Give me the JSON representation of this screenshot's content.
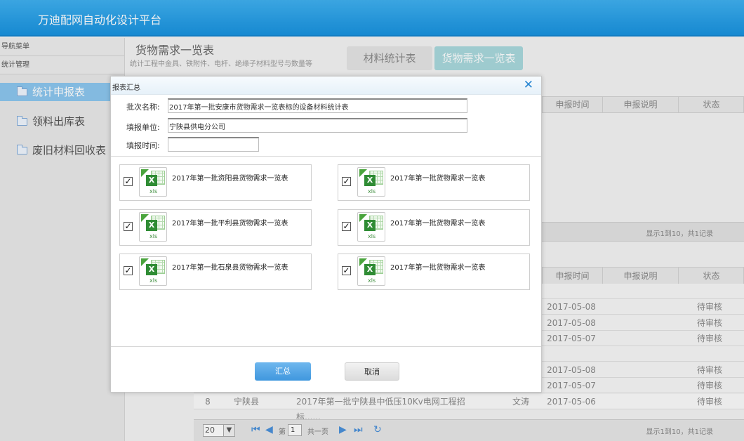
{
  "app": {
    "title": "万迪配网自动化设计平台"
  },
  "sidebar": {
    "nav_header": "导航菜单",
    "section_header": "统计管理",
    "items": [
      {
        "label": "统计申报表",
        "active": true
      },
      {
        "label": "领料出库表",
        "active": false
      },
      {
        "label": "废旧材料回收表",
        "active": false
      }
    ]
  },
  "main": {
    "title": "货物需求一览表",
    "subtitle": "统计工程中金具、铁附件、电杆、绝缘子材料型号与数量等",
    "tabs": [
      {
        "label": "材料统计表",
        "active": false
      },
      {
        "label": "货物需求一览表",
        "active": true
      }
    ],
    "upper_table": {
      "columns": [
        "申报时间",
        "申报说明",
        "状态"
      ]
    },
    "upper_summary": "显示1到10，共1记录",
    "lower_table": {
      "columns": [
        "申报时间",
        "申报说明",
        "状态"
      ],
      "rows": [
        {
          "date": "",
          "status": ""
        },
        {
          "date": "2017-05-08",
          "status": "待审核"
        },
        {
          "date": "2017-05-08",
          "status": "待审核"
        },
        {
          "date": "2017-05-07",
          "status": "待审核"
        },
        {
          "date": "",
          "status": ""
        },
        {
          "date": "2017-05-08",
          "status": "待审核"
        },
        {
          "date": "2017-05-07",
          "status": "待审核"
        },
        {
          "num": "8",
          "county": "宁陕县",
          "name": "2017年第一批宁陕县中低压10Kv电网工程招标......",
          "person": "文涛",
          "date": "2017-05-06",
          "status": "待审核"
        }
      ]
    },
    "pager": {
      "page_size": "20",
      "page_prefix": "第",
      "page_value": "1",
      "page_suffix": "共一页",
      "summary": "显示1到10，共1记录"
    }
  },
  "modal": {
    "title": "报表汇总",
    "batch_label": "批次名称:",
    "batch_value": "2017年第一批安康市货物需求一览表标的设备材料统计表",
    "unit_label": "填报单位:",
    "unit_value": "宁陕县供电分公司",
    "time_label": "填报时间:",
    "time_value": "",
    "files": [
      {
        "label": "2017年第一批资阳县货物需求一览表",
        "checked": true
      },
      {
        "label": "2017年第一批货物需求一览表",
        "checked": true
      },
      {
        "label": "2017年第一批平利县货物需求一览表",
        "checked": true
      },
      {
        "label": "2017年第一批货物需求一览表",
        "checked": true
      },
      {
        "label": "2017年第一批石泉县货物需求一览表",
        "checked": true
      },
      {
        "label": "2017年第一批货物需求一览表",
        "checked": true
      }
    ],
    "ok_label": "汇总",
    "cancel_label": "取消"
  }
}
